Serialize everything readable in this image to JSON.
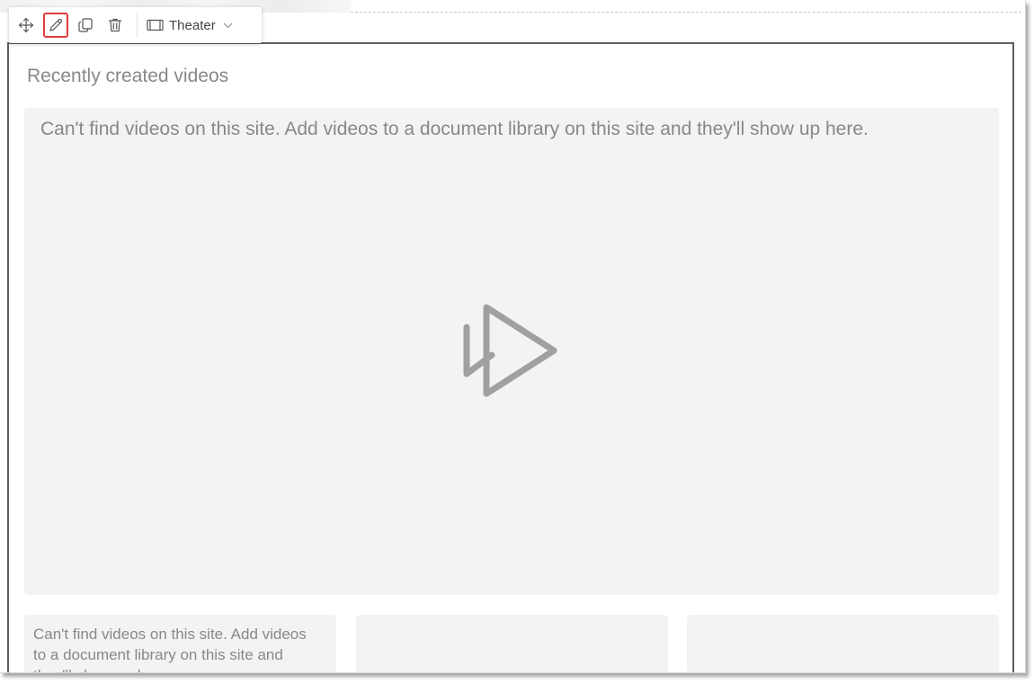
{
  "toolbar": {
    "move_icon": "move-icon",
    "edit_icon": "pencil-icon",
    "duplicate_icon": "duplicate-icon",
    "delete_icon": "trash-icon",
    "layout_icon": "film-icon",
    "layout_label": "Theater",
    "layout_chevron": "chevron-down-icon",
    "active_color": "#e03c3c"
  },
  "webpart": {
    "title": "Recently created videos",
    "hero": {
      "message": "Can't find videos on this site. Add videos to a document library on this site and they'll show up here.",
      "icon": "video-play-icon"
    },
    "cards": [
      {
        "message": "Can't find videos on this site. Add videos to a document library on this site and they'll show up here."
      },
      {
        "message": ""
      },
      {
        "message": ""
      }
    ]
  },
  "colors": {
    "placeholder_bg": "#f3f3f3",
    "muted_text": "#8a8886",
    "selection_border": "#5e5e5e"
  }
}
